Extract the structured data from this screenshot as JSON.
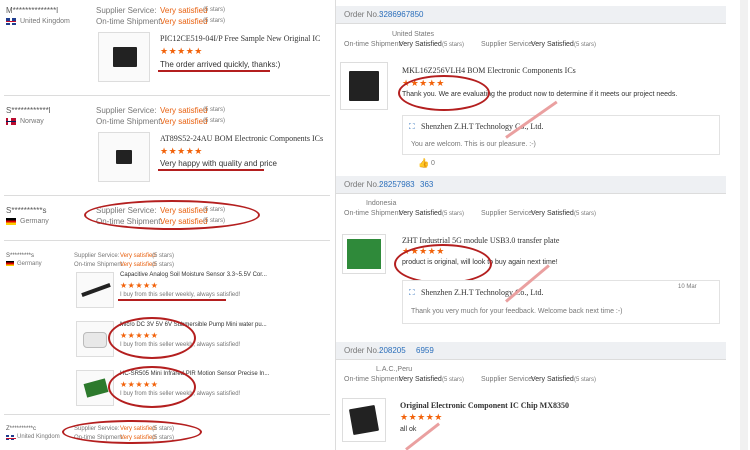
{
  "left_panel": {
    "reviews": [
      {
        "username": "M**************l",
        "country": "United Kingdom",
        "supplier_service_label": "Supplier Service:",
        "supplier_service_value": "Very satisfied",
        "supplier_service_stars": "(5 stars)",
        "shipment_label": "On-time Shipment:",
        "shipment_value": "Very satisfied",
        "shipment_stars": "(5 stars)",
        "product_title": "PIC12CE519-04I/P Free Sample New Original IC",
        "rating": "★★★★★",
        "comment": "The order arrived quickly, thanks:)"
      },
      {
        "username": "S************l",
        "country": "Norway",
        "supplier_service_label": "Supplier Service:",
        "supplier_service_value": "Very satisfied",
        "supplier_service_stars": "(5 stars)",
        "shipment_label": "On-time Shipment:",
        "shipment_value": "Very satisfied",
        "shipment_stars": "(5 stars)",
        "product_title": "AT89S52-24AU BOM Electronic Components ICs",
        "rating": "★★★★★",
        "comment": "Very happy with quality and price"
      },
      {
        "username": "S**********s",
        "country": "Germany",
        "supplier_service_label": "Supplier Service:",
        "supplier_service_value": "Very satisfied",
        "supplier_service_stars": "(5 stars)",
        "shipment_label": "On-time Shipment:",
        "shipment_value": "Very satisfied",
        "shipment_stars": "(5 stars)"
      },
      {
        "username": "S*********s",
        "country": "Germany",
        "supplier_service_label": "Supplier Service:",
        "supplier_service_value": "Very satisfied",
        "supplier_service_stars": "(5 stars)",
        "shipment_label": "On-time Shipment:",
        "shipment_value": "Very satisfied",
        "shipment_stars": "(5 stars)",
        "items": [
          {
            "title": "Capacitive Analog Soil Moisture Sensor 3.3~5.5V Cor...",
            "rating": "★★★★★",
            "comment": "I buy from this seller weekly, always satisfied!"
          },
          {
            "title": "Micro DC 3V 5V 6V Submersible Pump Mini water pu...",
            "rating": "★★★★★",
            "comment": "I buy from this seller weekly, always satisfied!"
          },
          {
            "title": "HC-SR505 Mini Infrared PIR Motion Sensor Precise In...",
            "rating": "★★★★★",
            "comment": "I buy from this seller weekly, always satisfied!"
          }
        ]
      },
      {
        "username": "Z**********c",
        "country": "United Kingdom",
        "supplier_service_label": "Supplier Service:",
        "supplier_service_value": "Very satisfied",
        "supplier_service_stars": "(5 stars)",
        "shipment_label": "On-time Shipment:",
        "shipment_value": "Very satisfied",
        "shipment_stars": "(5 stars)"
      }
    ]
  },
  "right_panel": {
    "orders": [
      {
        "order_label": "Order No.:",
        "order_number": "3286967850",
        "buyer": "United States",
        "shipment_label": "On-time Shipment:",
        "shipment_value": "Very Satisfied",
        "shipment_stars": "(5 stars)",
        "supplier_service_label": "Supplier Service:",
        "supplier_service_value": "Very Satisfied",
        "supplier_service_stars": "(5 stars)",
        "product_title": "MKL16Z256VLH4 BOM Electronic Components ICs",
        "rating": "★★★★★",
        "comment": "Thank you. We are evaluating the product now to determine if it meets our project needs.",
        "reply_company": "Shenzhen Z.H.T Technology Co., Ltd.",
        "reply_text": "You are welcom. This is our pleasure. :-)",
        "like_count": "0"
      },
      {
        "order_label": "Order No.:",
        "order_number": "28257983",
        "order_number_tail": "363",
        "buyer": "Indonesia",
        "shipment_label": "On-time Shipment:",
        "shipment_value": "Very Satisfied",
        "shipment_stars": "(5 stars)",
        "supplier_service_label": "Supplier Service:",
        "supplier_service_value": "Very Satisfied",
        "supplier_service_stars": "(5 stars)",
        "product_title": "ZHT Industrial 5G module USB3.0 transfer plate",
        "rating": "★★★★★",
        "comment": "product is original, will look to buy again next time!",
        "reply_company": "Shenzhen Z.H.T Technology Co., Ltd.",
        "reply_date": "10 Mar",
        "reply_text": "Thank you very much for your feedback. Welcome back next time :-)"
      },
      {
        "order_label": "Order No.:",
        "order_number": "208205",
        "order_number_tail": "6959",
        "buyer": "L.A.C.,Peru",
        "shipment_label": "On-time Shipment:",
        "shipment_value": "Very Satisfied",
        "shipment_stars": "(5 stars)",
        "supplier_service_label": "Supplier Service:",
        "supplier_service_value": "Very Satisfied",
        "supplier_service_stars": "(5 stars)",
        "product_title": "Original Electronic Component IC Chip MX8350",
        "rating": "★★★★★",
        "comment": "all ok"
      }
    ]
  },
  "colors": {
    "accent_orange": "#e8600f",
    "annotation_red": "#b41f1f",
    "order_bar": "#eef0f3",
    "link_blue": "#2a6ebb"
  }
}
